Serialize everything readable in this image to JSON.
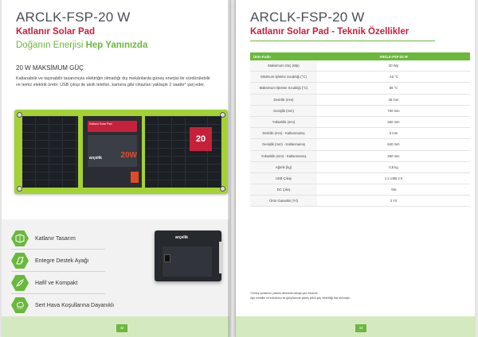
{
  "left": {
    "title": "ARCLK-FSP-20 W",
    "subtitle1": "Katlanır Solar Pad",
    "subtitle2_normal": "Doğanın Enerjisi",
    "subtitle2_bold": "Hep Yanınızda",
    "section_heading": "20 W MAKSİMUM GÜÇ",
    "body": "Katlanabilir ve taşınabilir tasarımıyla elektriğin olmadığı dış mekânlarda güneş enerjisi ile sürdürülebilir ve temiz elektrik üretir. USB çıkışı ile akıllı telefon, kamera gibi cihazları yaklaşık 2 saatte* şarj eder.",
    "panel": {
      "card_title": "Katlanır Solar Pad",
      "card_brand": "arçelik",
      "card_wattage": "20W",
      "badge": "20",
      "badge_caption": "Güneş Enerji Panel"
    },
    "features": [
      {
        "label": "Katlanır Tasarım",
        "icon": "fold-icon"
      },
      {
        "label": "Entegre Destek Ayağı",
        "icon": "stand-icon"
      },
      {
        "label": "Hafif ve Kompakt",
        "icon": "feather-icon"
      },
      {
        "label": "Sert Hava Koşullarına Dayanıklı",
        "icon": "weather-icon"
      }
    ],
    "folded_brand": "arçelik",
    "page_number": "42"
  },
  "right": {
    "title": "ARCLK-FSP-20 W",
    "subtitle": "Katlanır Solar Pad - Teknik Özellikler",
    "table_headers": [
      "Ürün Kodu",
      "ARCLK-FSP-20 W"
    ],
    "rows": [
      [
        "Maksimum Güç (Wp)",
        "20 Wp"
      ],
      [
        "Minimum İşletme Sıcaklığı (°C)",
        "-10 °C"
      ],
      [
        "Maksimum İşletme Sıcaklığı (°C)",
        "65 °C"
      ],
      [
        "Derinlik (mm)",
        "30 mm"
      ],
      [
        "Genişlik (mm)",
        "700 mm"
      ],
      [
        "Yükseklik (mm)",
        "260 mm"
      ],
      [
        "Derinlik (mm) - Katlanmamış",
        "5 mm"
      ],
      [
        "Genişlik (mm) - Katlanmamış",
        "640 mm"
      ],
      [
        "Yükseklik (mm) - Katlanmamış",
        "260 mm"
      ],
      [
        "Ağırlık (kg)",
        "0,8 kg"
      ],
      [
        "USB Çıkışı",
        "1 x USB 2.0"
      ],
      [
        "DC Çıkış",
        "Yok"
      ],
      [
        "Ürün Garantisi (Yıl)",
        "2 Yıl"
      ]
    ],
    "note1": "*Güneş ışınlarının yüksek derecede olduğu yaz mevsimi.",
    "note2": "Ağır metaller ve kobolzsuz bir gökyüzünde güneş yüklü şarj verimliliği baz alınmıştır.",
    "page_number": "43"
  },
  "colors": {
    "green": "#6ab83c",
    "red": "#c6213b",
    "panel_green": "#a4d235"
  }
}
